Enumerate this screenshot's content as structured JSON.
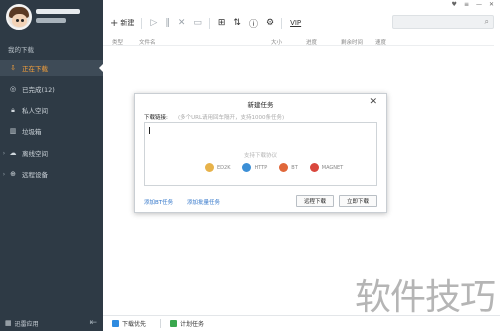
{
  "sidebar": {
    "section_title": "我的下载",
    "items": [
      {
        "label": "正在下载",
        "icon": "download-arrow-icon"
      },
      {
        "label": "已完成(12)",
        "icon": "check-circle-icon"
      },
      {
        "label": "私人空间",
        "icon": "lock-icon"
      },
      {
        "label": "垃圾箱",
        "icon": "trash-icon"
      },
      {
        "label": "离线空间",
        "icon": "cloud-icon"
      },
      {
        "label": "远程设备",
        "icon": "globe-icon"
      }
    ],
    "bottom_label": "迅雷应用"
  },
  "toolbar": {
    "new_label": "新建",
    "vip_label": "VIP"
  },
  "columns": {
    "type": "类型",
    "filename": "文件名",
    "size": "大小",
    "progress": "进度",
    "remaining": "剩余时间",
    "speed": "速度"
  },
  "bottombar": {
    "left_label": "下载优先",
    "right_label": "计划任务"
  },
  "dialog": {
    "title": "新建任务",
    "link_label": "下载链接:",
    "link_hint": "(多个URL请用回车隔开，支持1000条任务)",
    "protocols_title": "支持下载协议",
    "protocols": [
      "ED2K",
      "HTTP",
      "BT",
      "MAGNET"
    ],
    "add_bt": "添加BT任务",
    "add_batch": "添加批量任务",
    "remote_download": "远程下载",
    "download_now": "立即下载"
  },
  "watermark": "软件技巧",
  "colors": {
    "sidebar_bg": "#2e3a45",
    "active_accent": "#f8a23a",
    "link_blue": "#2f74c9"
  }
}
